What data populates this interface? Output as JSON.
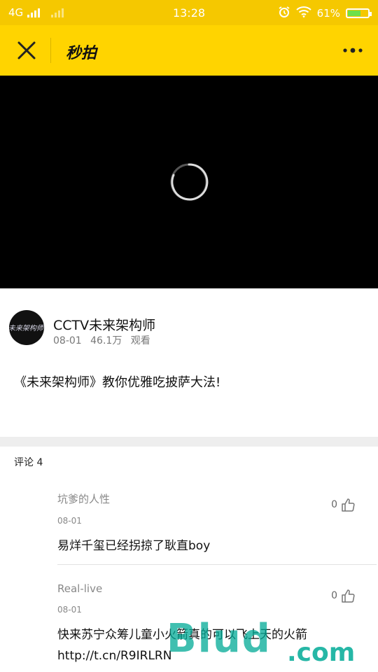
{
  "status_bar": {
    "network": "4G",
    "time": "13:28",
    "battery_percent": "61%",
    "battery_level": 0.61
  },
  "app_bar": {
    "title": "秒拍"
  },
  "video": {
    "state": "loading"
  },
  "author": {
    "name": "CCTV未来架构师",
    "avatar_text": "未来架构师",
    "date": "08-01",
    "views": "46.1万",
    "views_label": "观看",
    "video_title": "《未来架构师》教你优雅吃披萨大法!"
  },
  "comments": {
    "header": "评论 4",
    "items": [
      {
        "user": "坑爹的人性",
        "date": "08-01",
        "likes": "0",
        "text": "易烊千玺已经拐掠了耿直boy"
      },
      {
        "user": "Real-live",
        "date": "08-01",
        "likes": "0",
        "text": "快来苏宁众筹儿童小火箭真的可以飞上天的火箭http://t.cn/R9IRLRN"
      }
    ]
  },
  "watermark": {
    "main": "Blud",
    "suffix": ".com"
  },
  "colors": {
    "accent": "#ffd400",
    "status_bar": "#f5c800"
  }
}
